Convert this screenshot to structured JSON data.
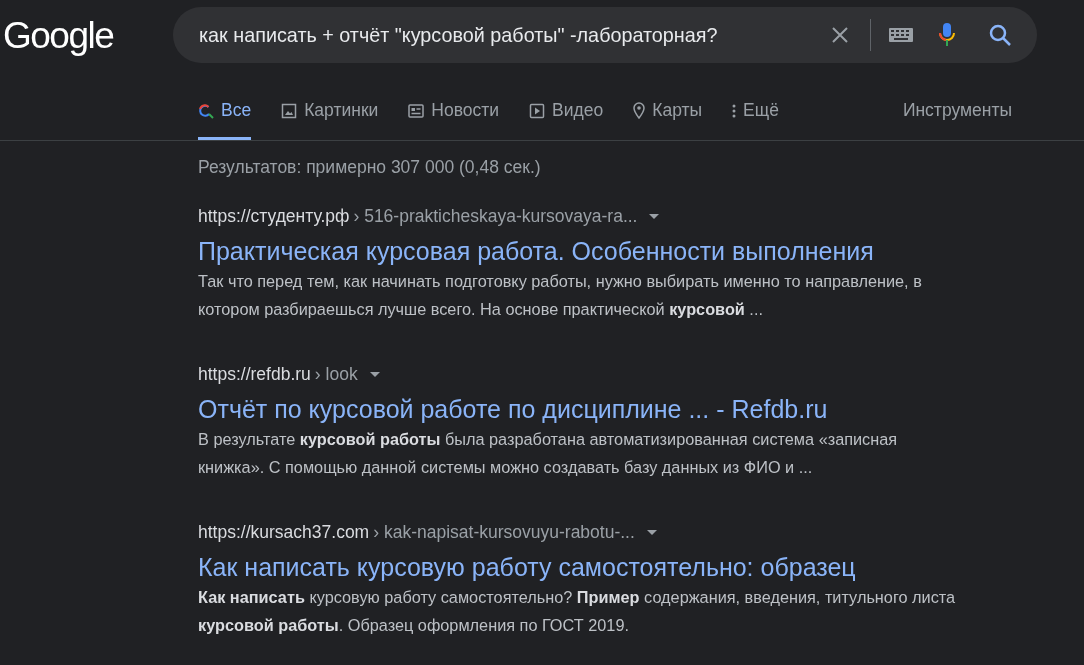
{
  "logo": "Google",
  "search": {
    "value": "как написать + отчёт \"курсовой работы\" -лабораторная?"
  },
  "tabs": [
    {
      "label": "Все",
      "kind": "search",
      "selected": true
    },
    {
      "label": "Картинки",
      "kind": "image",
      "selected": false
    },
    {
      "label": "Новости",
      "kind": "news",
      "selected": false
    },
    {
      "label": "Видео",
      "kind": "video",
      "selected": false
    },
    {
      "label": "Карты",
      "kind": "map",
      "selected": false
    },
    {
      "label": "Ещё",
      "kind": "more",
      "selected": false
    }
  ],
  "tools": "Инструменты",
  "result_stats": "Результатов: примерно 307 000 (0,48 сек.)",
  "results": [
    {
      "domain": "https://студенту.рф",
      "path": "› 516-prakticheskaya-kursovaya-ra...",
      "title": "Практическая курсовая работа. Особенности выполнения",
      "snippet": "Так что перед тем, как начинать подготовку работы, нужно выбирать именно то направление, в котором разбираешься лучше всего. На основе практической **курсовой** ..."
    },
    {
      "domain": "https://refdb.ru",
      "path": "› look",
      "title": "Отчёт по курсовой работе по дисциплине ... - Refdb.ru",
      "snippet": "В результате **курсовой работы** была разработана автоматизированная система «записная книжка». С помощью данной системы можно создавать базу данных из ФИО и ..."
    },
    {
      "domain": "https://kursach37.com",
      "path": "› kak-napisat-kursovuyu-rabotu-...",
      "title": "Как написать курсовую работу самостоятельно: образец",
      "snippet": "**Как написать** курсовую работу самостоятельно? **Пример** содержания, введения, титульного листа **курсовой работы**. Образец оформления по ГОСТ 2019."
    }
  ]
}
